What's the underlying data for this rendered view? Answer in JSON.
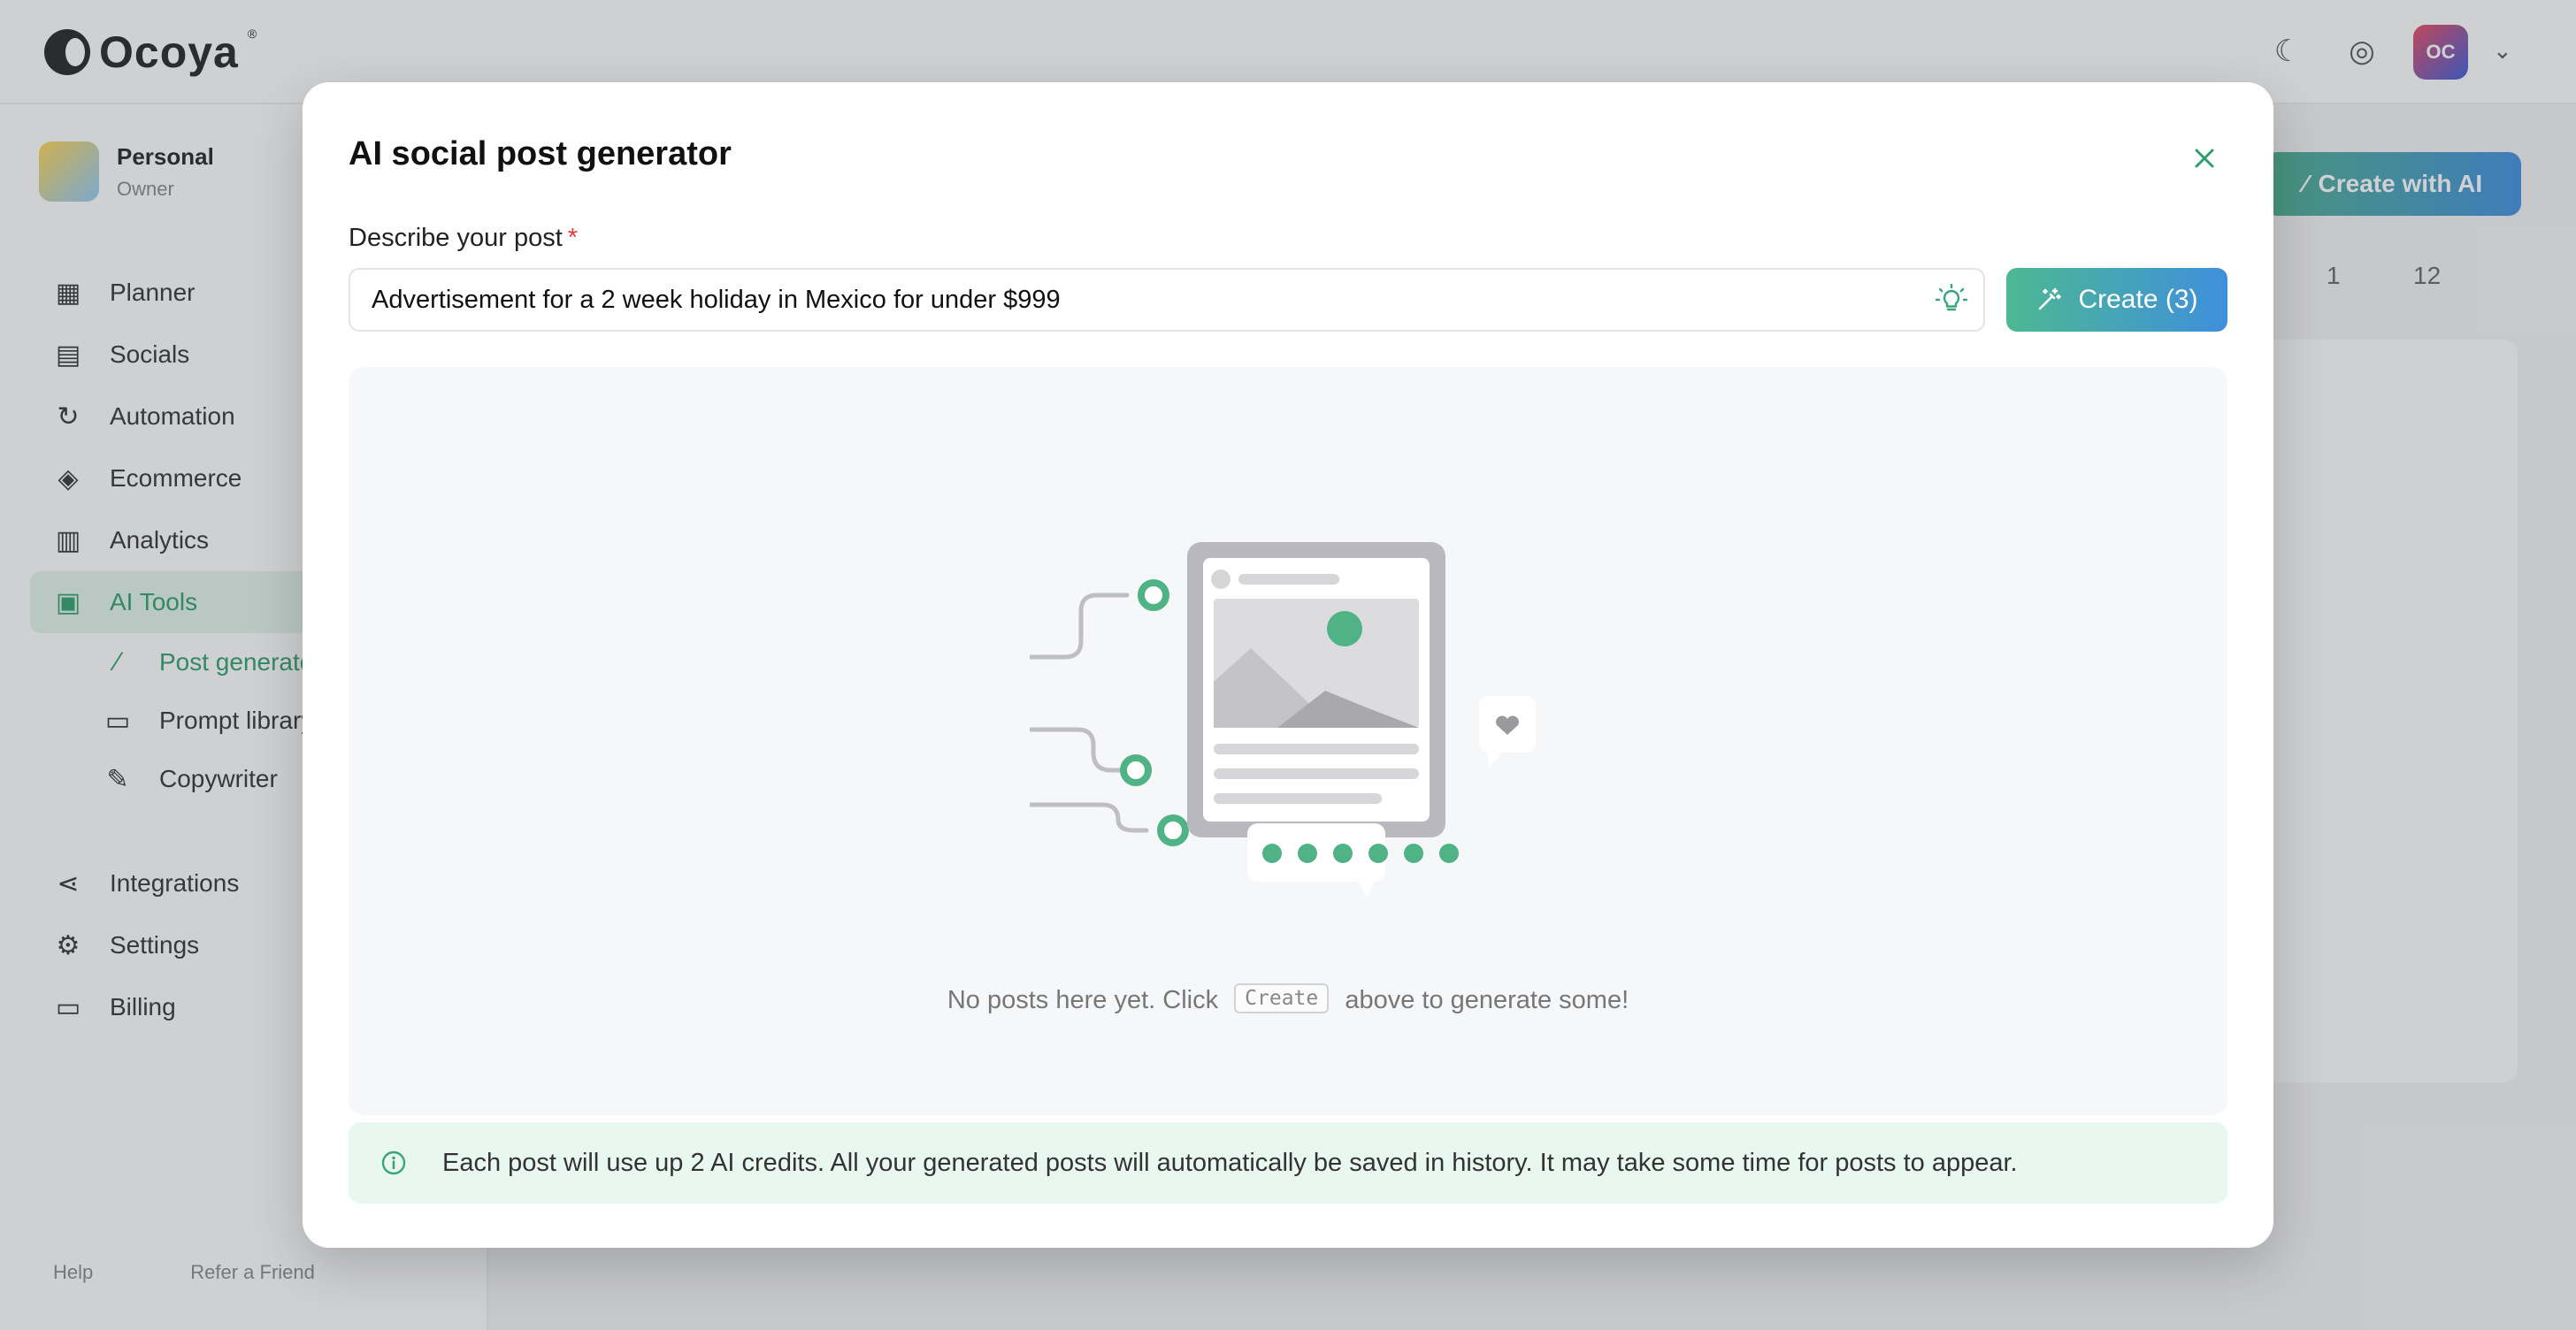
{
  "app": {
    "brand": "Ocoya",
    "brand_mark": "®",
    "avatar_initials": "OC"
  },
  "workspace": {
    "name": "Personal",
    "role": "Owner"
  },
  "sidebar": {
    "items": [
      {
        "label": "Planner",
        "icon": "calendar-icon"
      },
      {
        "label": "Socials",
        "icon": "socials-icon"
      },
      {
        "label": "Automation",
        "icon": "automation-icon"
      },
      {
        "label": "Ecommerce",
        "icon": "tag-icon"
      },
      {
        "label": "Analytics",
        "icon": "analytics-icon"
      },
      {
        "label": "AI Tools",
        "icon": "ai-tools-icon"
      }
    ],
    "sub_items": [
      {
        "label": "Post generator",
        "icon": "wand-icon"
      },
      {
        "label": "Prompt library",
        "icon": "library-icon"
      },
      {
        "label": "Copywriter",
        "icon": "pen-icon"
      }
    ],
    "bottom_items": [
      {
        "label": "Integrations",
        "icon": "share-icon"
      },
      {
        "label": "Settings",
        "icon": "gear-icon"
      },
      {
        "label": "Billing",
        "icon": "card-icon"
      }
    ],
    "footer": {
      "help": "Help",
      "refer": "Refer a Friend"
    }
  },
  "main": {
    "create_with_ai_label": "Create with AI",
    "page_indicator": "1",
    "per_page": "12"
  },
  "modal": {
    "title": "AI social post generator",
    "field_label": "Describe your post",
    "required_mark": "*",
    "prompt_value": "Advertisement for a 2 week holiday in Mexico for under $999",
    "create_label": "Create (3)",
    "empty_prefix": "No posts here yet. Click",
    "empty_kbd": "Create",
    "empty_suffix": "above to generate some!",
    "info_text": "Each post will use up 2 AI credits. All your generated posts will automatically be saved in history. It may take some time for posts to appear."
  },
  "colors": {
    "accent_green": "#4db892",
    "accent_blue": "#3f8fdc",
    "info_bg": "#e8f8f1",
    "required_red": "#e53935"
  }
}
